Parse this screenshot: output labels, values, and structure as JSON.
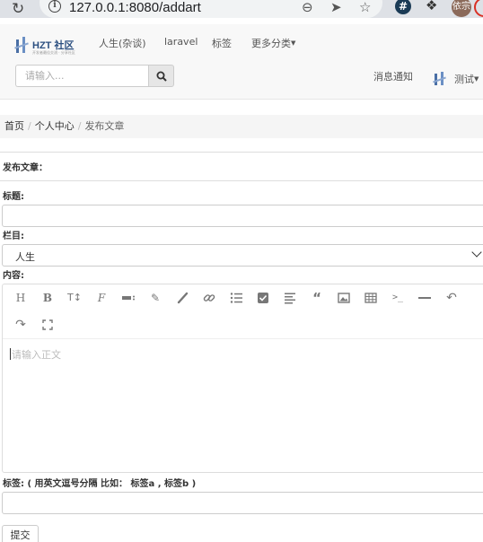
{
  "browser": {
    "url": "127.0.0.1:8080/addart",
    "profile_avatar_text": "依宗",
    "info_glyph": "i",
    "extension_glyph": "#"
  },
  "site": {
    "logo_text": "HZT 社区",
    "logo_subtext": "开发者最佳交流 · 分享社区",
    "nav": [
      "人生(杂谈)",
      "laravel",
      "标签",
      "更多分类"
    ],
    "search_placeholder": "请输入...",
    "notify_label": "消息通知",
    "user_name": "测试"
  },
  "breadcrumb": {
    "items": [
      "首页",
      "个人中心"
    ],
    "active": "发布文章",
    "separator": "/"
  },
  "form": {
    "heading": "发布文章：",
    "title_label": "标题:",
    "title_value": "",
    "category_label": "栏目:",
    "category_selected": "人生",
    "content_label": "内容:",
    "content_placeholder": "请输入正文",
    "tags_label": "标签: ( 用英文逗号分隔 比如： 标签a , 标签b )",
    "tags_value": "",
    "submit_label": "提交"
  },
  "editor_toolbar": [
    "heading-icon",
    "bold-icon",
    "text-size-icon",
    "strikethrough-icon",
    "block-icon",
    "pencil-icon",
    "brush-icon",
    "link-icon",
    "list-icon",
    "checkbox-icon",
    "align-icon",
    "quote-icon",
    "image-icon",
    "table-icon",
    "code-icon",
    "hr-icon",
    "undo-icon",
    "redo-icon",
    "fullscreen-icon"
  ],
  "colors": {
    "brand": "#2b4f80",
    "navbar_bg": "#f8f8f8",
    "breadcrumb_bg": "#f5f5f5"
  }
}
